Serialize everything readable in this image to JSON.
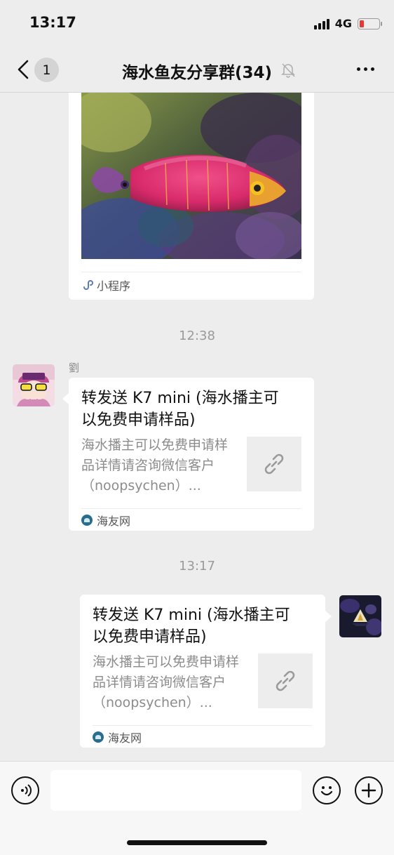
{
  "status_bar": {
    "time": "13:17",
    "network": "4G"
  },
  "nav": {
    "unread_count": "1",
    "title": "海水鱼友分享群(34)"
  },
  "messages": [
    {
      "type": "mini_program",
      "footer_label": "小程序"
    },
    {
      "type": "timestamp",
      "text": "12:38"
    },
    {
      "type": "link_card",
      "sender": "劉",
      "title": "转发送 K7 mini (海水播主可以免费申请样品)",
      "description": "海水播主可以免费申请样品详情请咨询微信客户（noopsychen）...",
      "source": "海友网"
    },
    {
      "type": "timestamp",
      "text": "13:17"
    },
    {
      "type": "link_card",
      "sender": "",
      "title": "转发送 K7 mini (海水播主可以免费申请样品)",
      "description": "海水播主可以免费申请样品详情请咨询微信客户（noopsychen）...",
      "source": "海友网"
    }
  ],
  "input": {
    "placeholder": ""
  },
  "colors": {
    "background": "#ededed",
    "bubble": "#ffffff",
    "battery_low": "#e53935",
    "source_icon": "#2a6d8a"
  },
  "icons": {
    "signal": "signal-icon",
    "battery": "battery-icon",
    "back": "chevron-left-icon",
    "mute": "bell-off-icon",
    "more": "more-icon",
    "mini_program": "mini-program-icon",
    "link": "link-icon",
    "voice": "voice-icon",
    "emoji": "emoji-icon",
    "plus": "plus-icon"
  }
}
